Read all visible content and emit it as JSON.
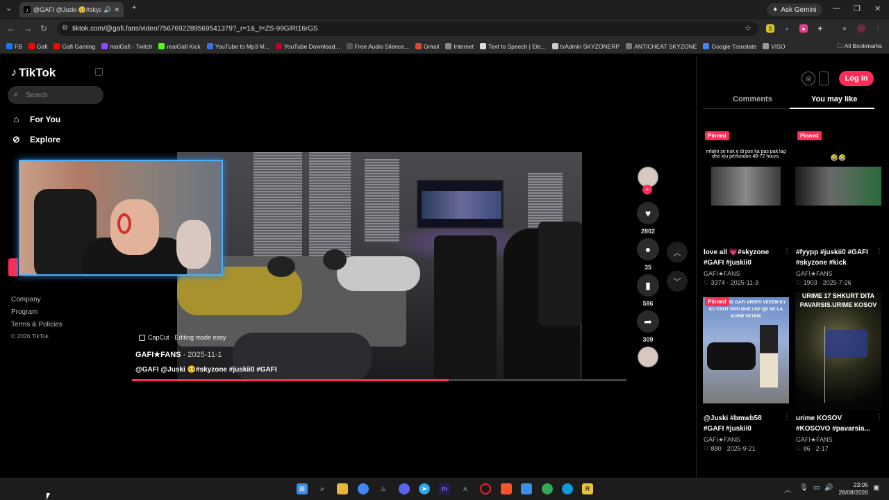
{
  "browser": {
    "tab_title": "@GAFI @Juski 🥺#skyzone",
    "tab_close": "✕",
    "new_tab": "+",
    "ask_gemini": "Ask Gemini",
    "url": "tiktok.com/@gafi.fans/video/7567692289569541379?_r=1&_t=ZS-99GlRt16rGS",
    "bookmarks": [
      {
        "label": "FB",
        "color": "#1877f2"
      },
      {
        "label": "Gafi",
        "color": "#ff0000"
      },
      {
        "label": "Gafi Gaming",
        "color": "#ff0000"
      },
      {
        "label": "realGafi - Twitch",
        "color": "#9146ff"
      },
      {
        "label": "realGafi Kick",
        "color": "#53fc18"
      },
      {
        "label": "YouTube to Mp3 M...",
        "color": "#3a6ee8"
      },
      {
        "label": "YouTube Download...",
        "color": "#c00030"
      },
      {
        "label": "Free Audio Silence...",
        "color": "#555555"
      },
      {
        "label": "Gmail",
        "color": "#ea4335"
      },
      {
        "label": "Internet",
        "color": "#888888"
      },
      {
        "label": "Text to Speech | Ele...",
        "color": "#dddddd"
      },
      {
        "label": "txAdmin SKYZONERP",
        "color": "#cccccc"
      },
      {
        "label": "ANTICHEAT SKYZONE",
        "color": "#777777"
      },
      {
        "label": "Google Translate",
        "color": "#4285f4"
      },
      {
        "label": "VISO",
        "color": "#999999"
      }
    ],
    "all_bookmarks": "All Bookmarks"
  },
  "sidebar": {
    "logo": "TikTok",
    "search_placeholder": "Search",
    "nav": [
      {
        "label": "For You",
        "icon": "home-icon"
      },
      {
        "label": "Explore",
        "icon": "compass-icon"
      }
    ],
    "links": [
      "Company",
      "Program",
      "Terms & Policies",
      "© 2026 TikTok"
    ]
  },
  "video": {
    "capcut": "CapCut · Editing made easy",
    "author": "GAFI★FANS",
    "date": " · 2025-11-1",
    "description": "@GAFI @Juski 🥺#skyzone #juskii0 #GAFI",
    "progress": 0.64
  },
  "actions": {
    "likes": "2802",
    "comments": "35",
    "saves": "586",
    "shares": "309"
  },
  "right": {
    "login": "Log in",
    "tab_comments": "Comments",
    "tab_you_may_like": "You may like",
    "cards": [
      {
        "pinned": "Pinned",
        "overlay": "mfalni se nuk e di pse ka pas pak lag dhe ktu përfundon 48-72 hours.",
        "caption": "love all 💗#skyzone #GAFI #juskii0",
        "author": "GAFI★FANS",
        "likes": "3374",
        "date": "2025-11-3"
      },
      {
        "pinned": "Pinned",
        "overlay": "🤣🤣",
        "caption": "#fyypp #juskii0 #GAFI #skyzone #kick",
        "author": "GAFI★FANS",
        "likes": "1903",
        "date": "2025-7-26"
      },
      {
        "pinned": "Pinned",
        "overlay": "DONI SI DHE GAFI ARRITI VETEM KY KU ESHT PATI DHE I NP QE SE LA KURR VETEM",
        "caption": "@Juski #bmwb58 #GAFI #juskii0",
        "author": "GAFI★FANS",
        "likes": "880",
        "date": "2025-9-21"
      },
      {
        "pinned": "",
        "overlay": "URIME 17 SHKURT DITA PAVARSIS.URIME KOSOV",
        "caption": "urime KOSOV #KOSOVO #pavarsia...",
        "author": "GAFI★FANS",
        "likes": "86",
        "date": "2-17"
      }
    ]
  },
  "taskbar": {
    "time": "23:05",
    "date": "28/08/2026"
  }
}
